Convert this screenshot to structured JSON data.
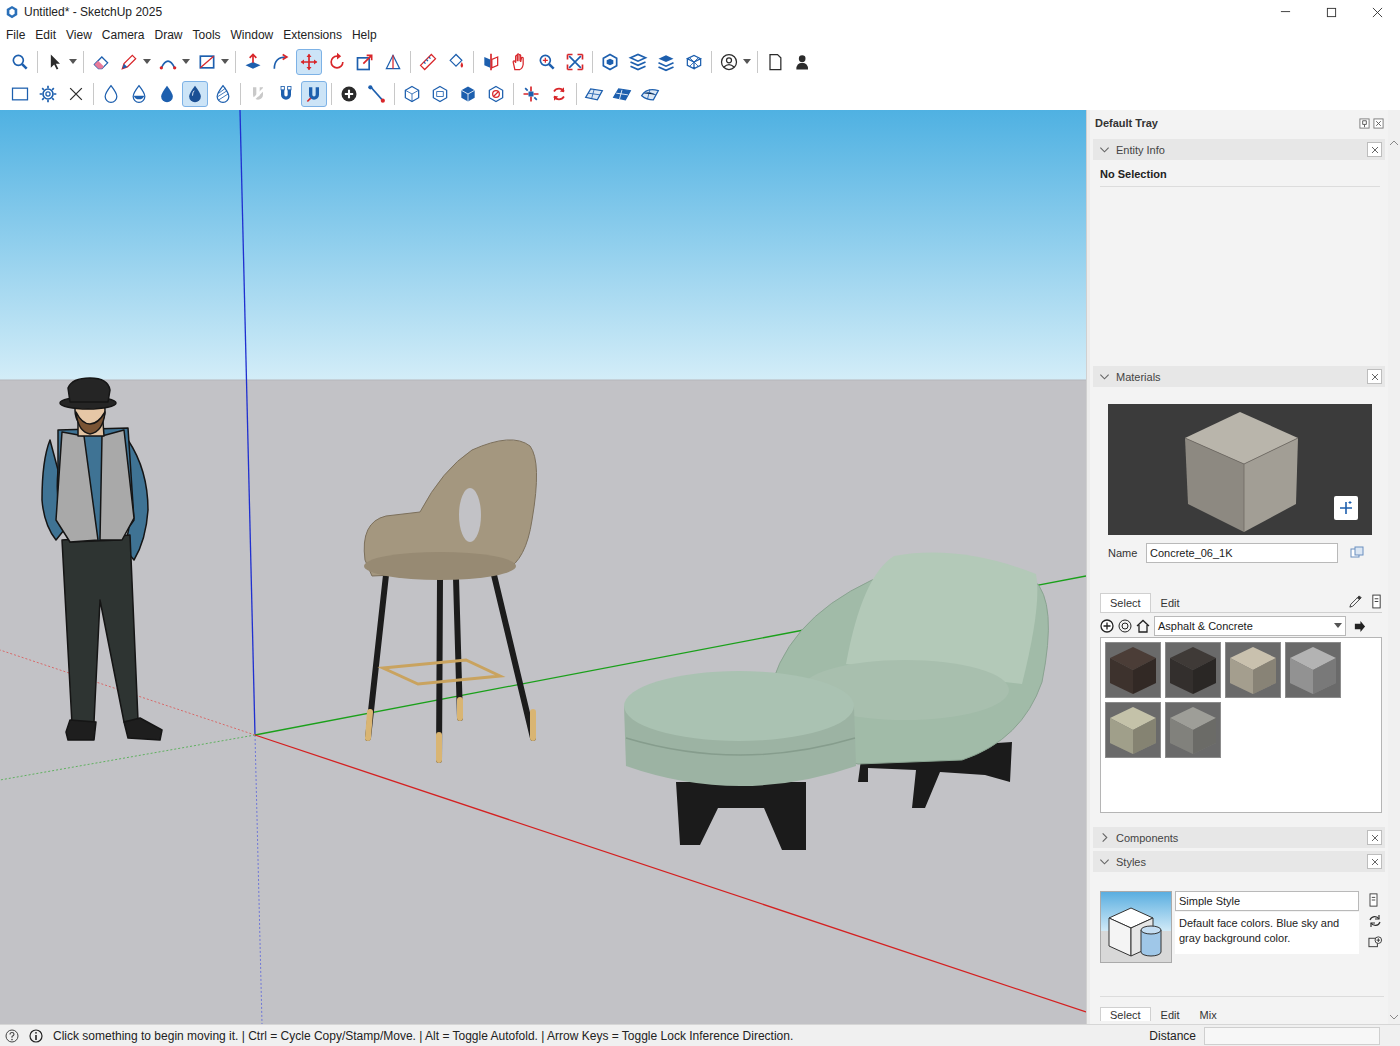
{
  "window": {
    "title": "Untitled* - SketchUp 2025"
  },
  "menu": [
    "File",
    "Edit",
    "View",
    "Camera",
    "Draw",
    "Tools",
    "Window",
    "Extensions",
    "Help"
  ],
  "toolbars": [
    [
      {
        "kind": "zoom",
        "selected": false,
        "menu_arrow": false
      },
      {
        "kind": "separator"
      },
      {
        "kind": "select",
        "selected": false,
        "menu_arrow": true
      },
      {
        "kind": "separator"
      },
      {
        "kind": "eraser",
        "selected": false,
        "menu_arrow": false
      },
      {
        "kind": "pencil",
        "selected": false,
        "menu_arrow": true
      },
      {
        "kind": "arc",
        "selected": false,
        "menu_arrow": true
      },
      {
        "kind": "rectangle",
        "selected": false,
        "menu_arrow": true
      },
      {
        "kind": "separator"
      },
      {
        "kind": "pushpull",
        "selected": false,
        "menu_arrow": false
      },
      {
        "kind": "followme",
        "selected": false,
        "menu_arrow": false
      },
      {
        "kind": "move",
        "selected": true,
        "menu_arrow": false
      },
      {
        "kind": "rotate",
        "selected": false,
        "menu_arrow": false
      },
      {
        "kind": "scale",
        "selected": false,
        "menu_arrow": false
      },
      {
        "kind": "offset",
        "selected": false,
        "menu_arrow": false
      },
      {
        "kind": "separator"
      },
      {
        "kind": "tape",
        "selected": false,
        "menu_arrow": false
      },
      {
        "kind": "paint",
        "selected": false,
        "menu_arrow": false
      },
      {
        "kind": "separator"
      },
      {
        "kind": "section",
        "selected": false,
        "menu_arrow": false
      },
      {
        "kind": "pan",
        "selected": false,
        "menu_arrow": false
      },
      {
        "kind": "zoomwin",
        "selected": false,
        "menu_arrow": false
      },
      {
        "kind": "zoomext",
        "selected": false,
        "menu_arrow": false
      },
      {
        "kind": "separator"
      },
      {
        "kind": "warehouse",
        "selected": false,
        "menu_arrow": false
      },
      {
        "kind": "layers",
        "selected": false,
        "menu_arrow": false
      },
      {
        "kind": "scenes",
        "selected": false,
        "menu_arrow": false
      },
      {
        "kind": "solid",
        "selected": false,
        "menu_arrow": false
      },
      {
        "kind": "separator"
      },
      {
        "kind": "account",
        "selected": false,
        "menu_arrow": true
      },
      {
        "kind": "separator"
      },
      {
        "kind": "newfile",
        "selected": false,
        "menu_arrow": false
      },
      {
        "kind": "profile",
        "selected": false,
        "menu_arrow": false
      }
    ],
    [
      {
        "kind": "box",
        "selected": false,
        "menu_arrow": false
      },
      {
        "kind": "gear",
        "selected": false,
        "menu_arrow": false
      },
      {
        "kind": "cross",
        "selected": false,
        "menu_arrow": false
      },
      {
        "kind": "separator"
      },
      {
        "kind": "drop1",
        "selected": false,
        "menu_arrow": false
      },
      {
        "kind": "drop2",
        "selected": false,
        "menu_arrow": false
      },
      {
        "kind": "drop3",
        "selected": false,
        "menu_arrow": false
      },
      {
        "kind": "drop4",
        "selected": true,
        "menu_arrow": false
      },
      {
        "kind": "drop5",
        "selected": false,
        "menu_arrow": false
      },
      {
        "kind": "separator"
      },
      {
        "kind": "erase2",
        "selected": false,
        "menu_arrow": false
      },
      {
        "kind": "magnet1",
        "selected": false,
        "menu_arrow": false
      },
      {
        "kind": "magnet2",
        "selected": true,
        "menu_arrow": false
      },
      {
        "kind": "separator"
      },
      {
        "kind": "addpoint",
        "selected": false,
        "menu_arrow": false
      },
      {
        "kind": "line",
        "selected": false,
        "menu_arrow": false
      },
      {
        "kind": "separator"
      },
      {
        "kind": "cube1",
        "selected": false,
        "menu_arrow": false
      },
      {
        "kind": "cube2",
        "selected": false,
        "menu_arrow": false
      },
      {
        "kind": "cube3",
        "selected": false,
        "menu_arrow": false
      },
      {
        "kind": "cube4",
        "selected": false,
        "menu_arrow": false
      },
      {
        "kind": "separator"
      },
      {
        "kind": "explode",
        "selected": false,
        "menu_arrow": false
      },
      {
        "kind": "cycle",
        "selected": false,
        "menu_arrow": false
      },
      {
        "kind": "separator"
      },
      {
        "kind": "mesh1",
        "selected": false,
        "menu_arrow": false
      },
      {
        "kind": "mesh2",
        "selected": false,
        "menu_arrow": false
      },
      {
        "kind": "mesh3",
        "selected": false,
        "menu_arrow": false
      }
    ]
  ],
  "tray": {
    "title": "Default Tray",
    "entity_info": {
      "title": "Entity Info",
      "expanded": true,
      "selection": "No Selection"
    },
    "materials": {
      "title": "Materials",
      "expanded": true,
      "name_label": "Name",
      "name": "Concrete_06_1K",
      "tabs": [
        {
          "label": "Select",
          "selected": true
        },
        {
          "label": "Edit",
          "selected": false
        }
      ],
      "collection": "Asphalt & Concrete",
      "swatches": [
        {
          "color": "#4b3d37"
        },
        {
          "color": "#3f3a37"
        },
        {
          "color": "#c9c1ae"
        },
        {
          "color": "#b3b3b3"
        },
        {
          "color": "#c4c2a9"
        },
        {
          "color": "#9e9e98"
        }
      ]
    },
    "components": {
      "title": "Components",
      "expanded": false
    },
    "styles": {
      "title": "Styles",
      "expanded": true,
      "style_name": "Simple Style",
      "description": "Default face colors. Blue sky and gray background color.",
      "tabs": [
        {
          "label": "Select",
          "selected": true
        },
        {
          "label": "Edit",
          "selected": false
        },
        {
          "label": "Mix",
          "selected": false
        }
      ]
    }
  },
  "status_bar": {
    "message": "Click something to begin moving it. | Ctrl = Cycle Copy/Stamp/Move. | Alt = Toggle Autofold. | Arrow Keys = Toggle Lock Inference Direction.",
    "measurement_label": "Distance"
  }
}
